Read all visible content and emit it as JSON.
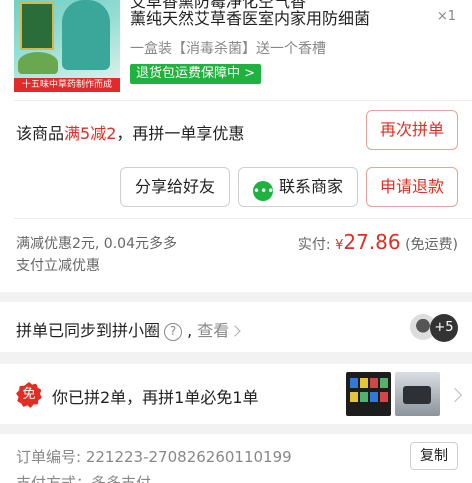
{
  "product": {
    "title_line1": "艾草香熏防霉净化空气香",
    "title_line2": "薰纯天然艾草香医室内家用防细菌",
    "quantity": "×1",
    "spec": "一盒装【消毒杀菌】送一个香槽",
    "guarantee": "退货包运费保障中",
    "thumb_strip": "十五味中草药制作而成"
  },
  "promo": {
    "prefix": "该商品",
    "highlight": "满5减2",
    "suffix": "，再拼一单享优惠",
    "again_button": "再次拼单"
  },
  "actions": {
    "share": "分享给好友",
    "contact": "联系商家",
    "refund": "申请退款"
  },
  "payment": {
    "discount_line1": "满减优惠2元, 0.04元多多",
    "discount_line2": "支付立减优惠",
    "paid_label": "实付:",
    "currency": "¥",
    "amount": "27.86",
    "shipping_note": "(免运费)"
  },
  "sync": {
    "text": "拼单已同步到拼小圈",
    "help": "?",
    "comma": ",",
    "view": "查看",
    "more_count": "+5"
  },
  "free_order": {
    "badge": "免",
    "text": "你已拼2单，再拼1单必免1单"
  },
  "order_info": {
    "order_no_label": "订单编号:",
    "order_no": "221223-270826260110199",
    "pay_method": "支付方式：多多支付",
    "copy_button": "复制"
  },
  "colors": {
    "accent_red": "#e02e24",
    "guarantee_green": "#1fb23f"
  }
}
